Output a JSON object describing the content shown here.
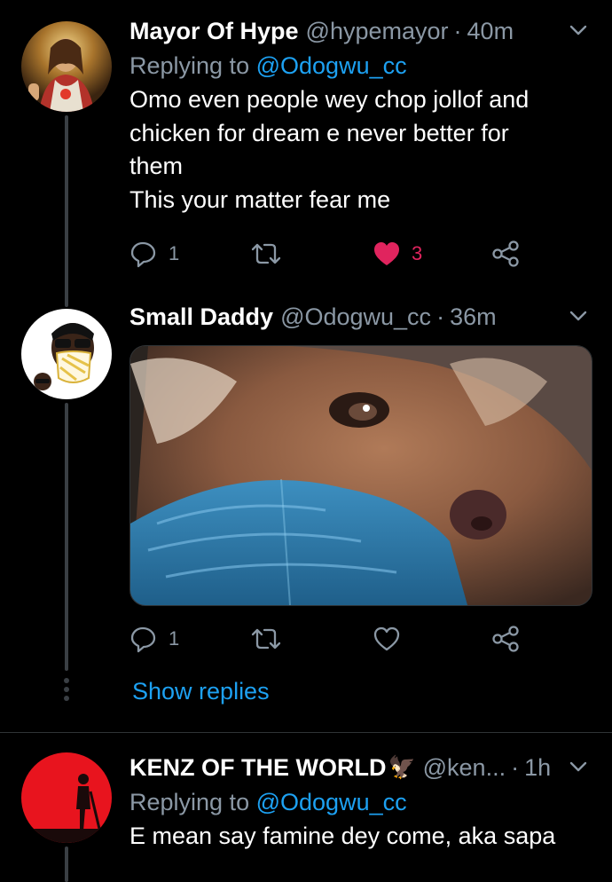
{
  "tweets": [
    {
      "name": "Mayor Of Hype",
      "handle": "@hypemayor",
      "dot": "·",
      "time": "40m",
      "replying_prefix": "Replying to",
      "replying_to": "@Odogwu_cc",
      "body": "Omo even people wey chop jollof and chicken for dream e never better for them\nThis your matter fear me",
      "replies": "1",
      "likes": "3",
      "liked": true
    },
    {
      "name": "Small Daddy",
      "handle": "@Odogwu_cc",
      "dot": "·",
      "time": "36m",
      "replies": "1",
      "show_replies": "Show replies"
    },
    {
      "name": "KENZ OF THE WORLD",
      "name_emoji": "🦅",
      "handle": "@ken...",
      "dot": "·",
      "time": "1h",
      "replying_prefix": "Replying to",
      "replying_to": "@Odogwu_cc",
      "body": "E mean say famine dey come, aka sapa"
    }
  ],
  "colors": {
    "background": "#000000",
    "secondary_text": "#8b98a5",
    "link": "#1da1f2",
    "like": "#e0245e"
  },
  "icons": [
    "reply-icon",
    "retweet-icon",
    "like-icon",
    "share-icon",
    "chevron-down-icon"
  ]
}
